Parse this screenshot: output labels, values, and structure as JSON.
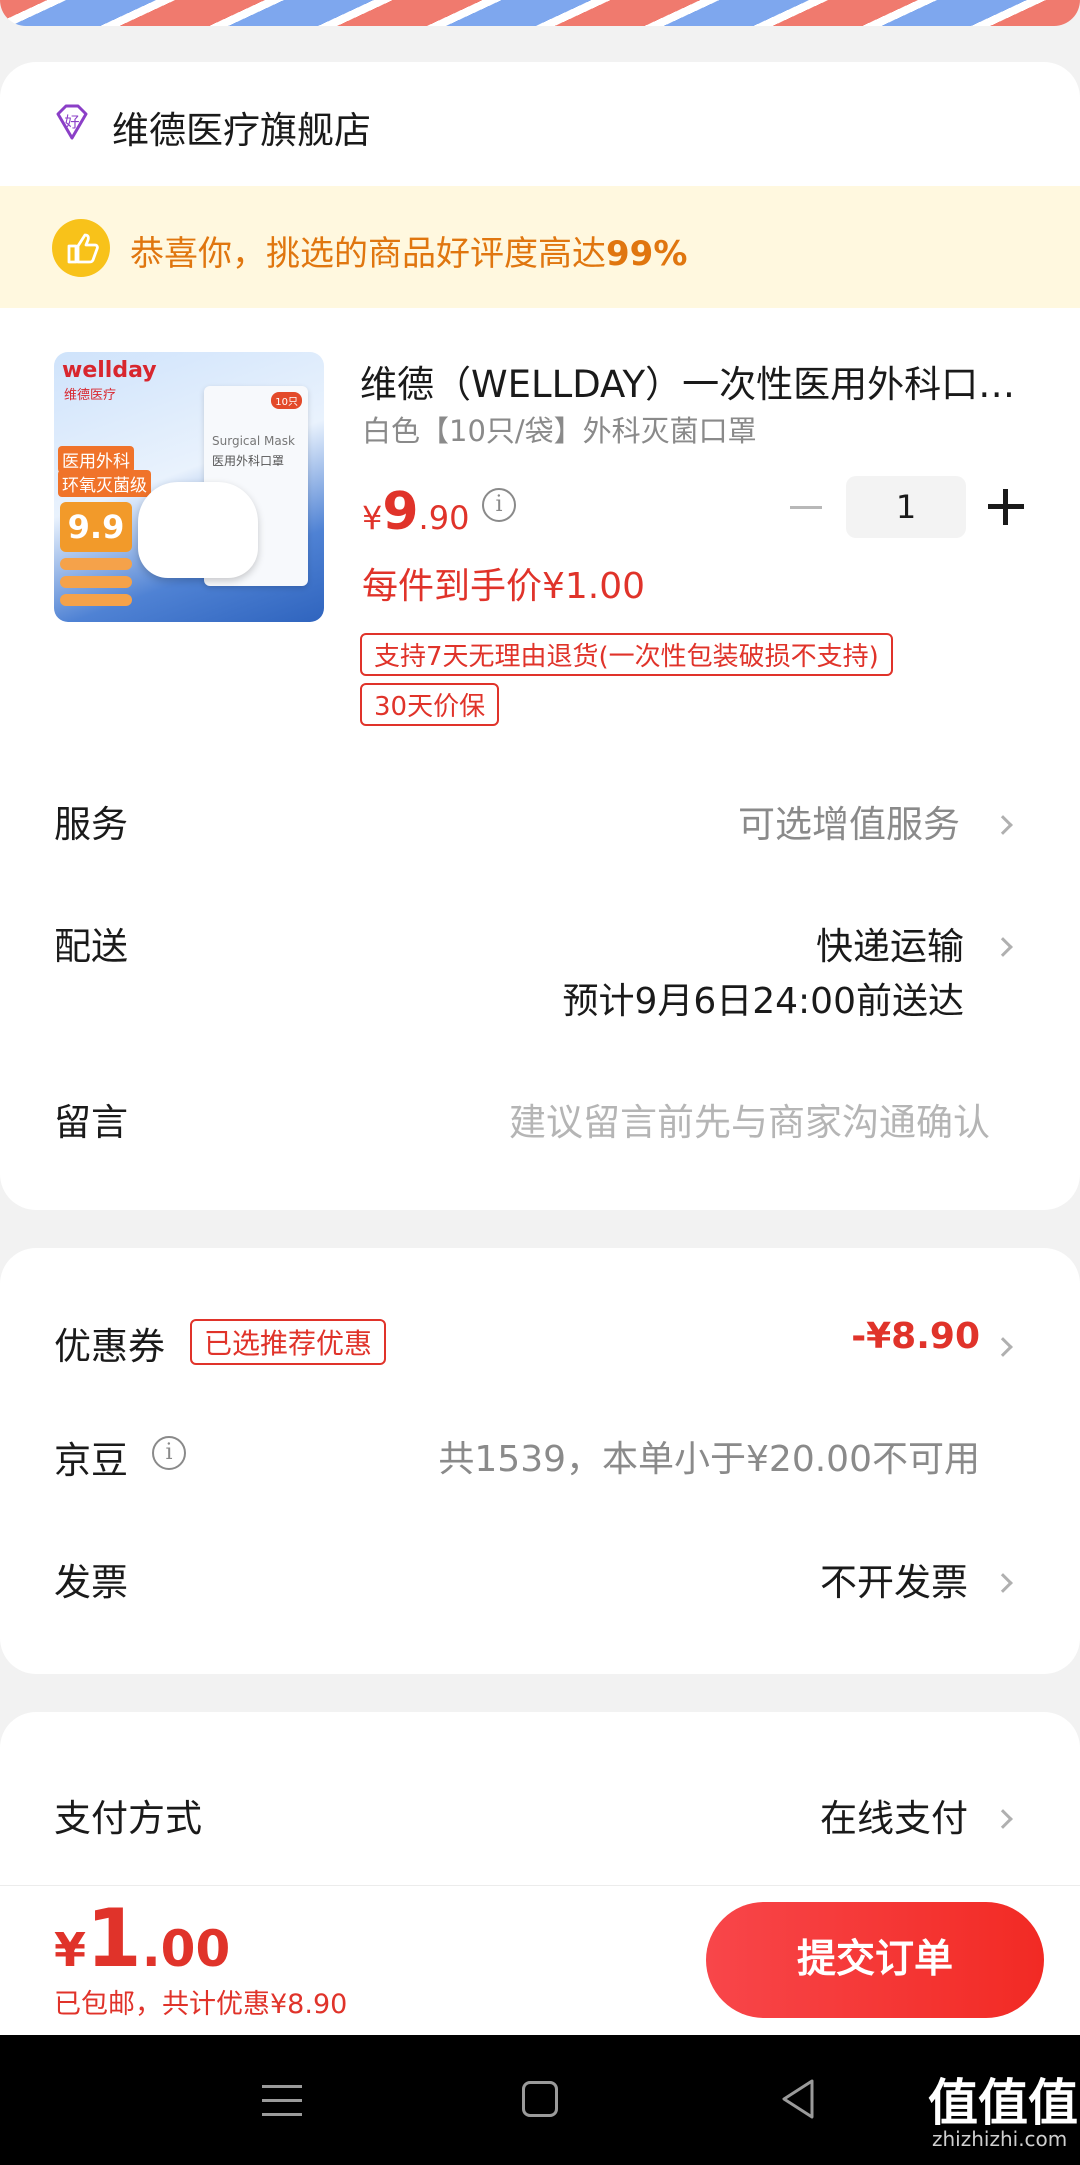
{
  "store": {
    "name": "维德医疗旗舰店",
    "icon": "good-store-icon"
  },
  "banner": {
    "text_prefix": "恭喜你，挑选的商品好评度高达",
    "rate": "99%"
  },
  "product": {
    "thumb_brand": "wellday",
    "thumb_brand_cn": "维德医疗",
    "thumb_pack": "Surgical Mask",
    "thumb_pack_cn": "医用外科口罩",
    "thumb_count": "10只",
    "thumb_line1": "医用外科",
    "thumb_line2": "环氧灭菌级",
    "thumb_price": "9.9",
    "title": "维德（WELLDAY）一次性医用外科口…",
    "spec": "白色【10只/袋】外科灭菌口罩",
    "price_symbol": "¥",
    "price_int": "9",
    "price_dec": ".90",
    "quantity": "1",
    "final_price": "每件到手价¥1.00",
    "tags": [
      "支持7天无理由退货(一次性包装破损不支持)",
      "30天价保"
    ]
  },
  "service": {
    "label": "服务",
    "value": "可选增值服务"
  },
  "delivery": {
    "label": "配送",
    "value": "快递运输",
    "eta": "预计9月6日24:00前送达"
  },
  "message": {
    "label": "留言",
    "placeholder": "建议留言前先与商家沟通确认"
  },
  "coupon": {
    "label": "优惠券",
    "badge": "已选推荐优惠",
    "value": "-¥8.90"
  },
  "jingdou": {
    "label": "京豆",
    "value": "共1539，本单小于¥20.00不可用"
  },
  "invoice": {
    "label": "发票",
    "value": "不开发票"
  },
  "payment": {
    "label": "支付方式",
    "value": "在线支付"
  },
  "total": {
    "symbol": "¥",
    "int": "1",
    "dec": ".00",
    "note": "已包邮，共计优惠¥8.90",
    "submit": "提交订单"
  },
  "watermark": {
    "logo": "值值值",
    "url": "zhizhizhi.com"
  },
  "colors": {
    "accent": "#e0332a",
    "banner_bg": "#fff8df",
    "banner_text": "#e0760f",
    "button": "#f2302a"
  }
}
